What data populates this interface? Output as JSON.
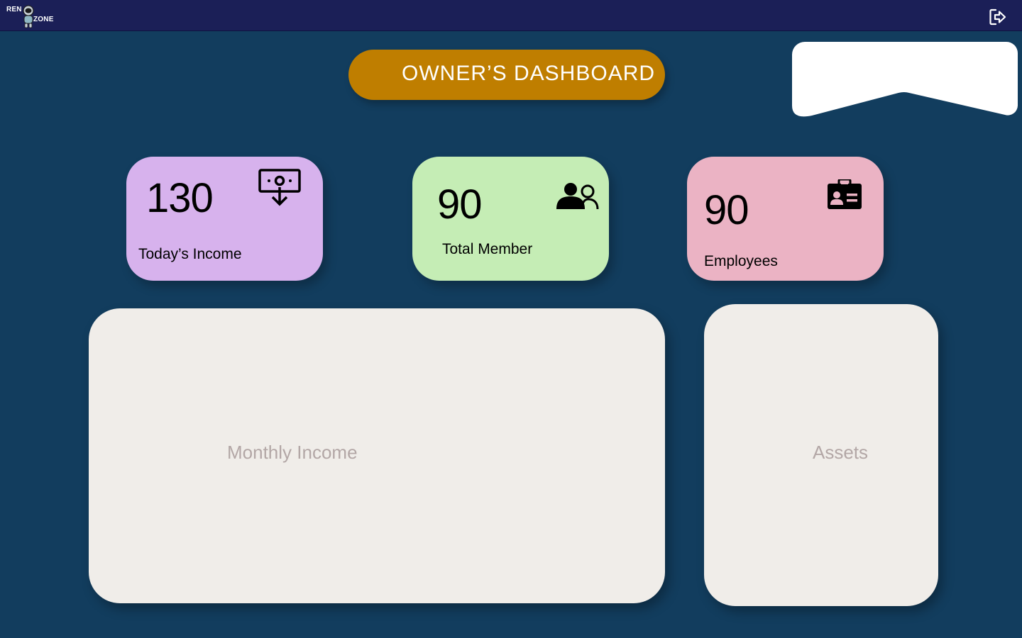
{
  "header": {
    "logo_top_text": "REN",
    "logo_bottom_text": "ZONE",
    "logo_icon": "astronaut-icon",
    "logout_icon": "logout-icon"
  },
  "page_title": "OWNER’S DASHBOARD",
  "stats": [
    {
      "value": "130",
      "label": "Today’s Income",
      "icon": "income-icon",
      "color": "#d7b2ed"
    },
    {
      "value": "90",
      "label": "Total Member",
      "icon": "members-icon",
      "color": "#c5edb5"
    },
    {
      "value": "90",
      "label": "Employees",
      "icon": "id-card-icon",
      "color": "#ebb3c4"
    }
  ],
  "panels": {
    "monthly_income": "Monthly Income",
    "assets": "Assets"
  },
  "colors": {
    "background": "#123d5e",
    "topbar": "#1b1f57",
    "title_pill": "#bf7e00",
    "panel": "#f0ede9",
    "panel_text": "#b3a7a6"
  }
}
